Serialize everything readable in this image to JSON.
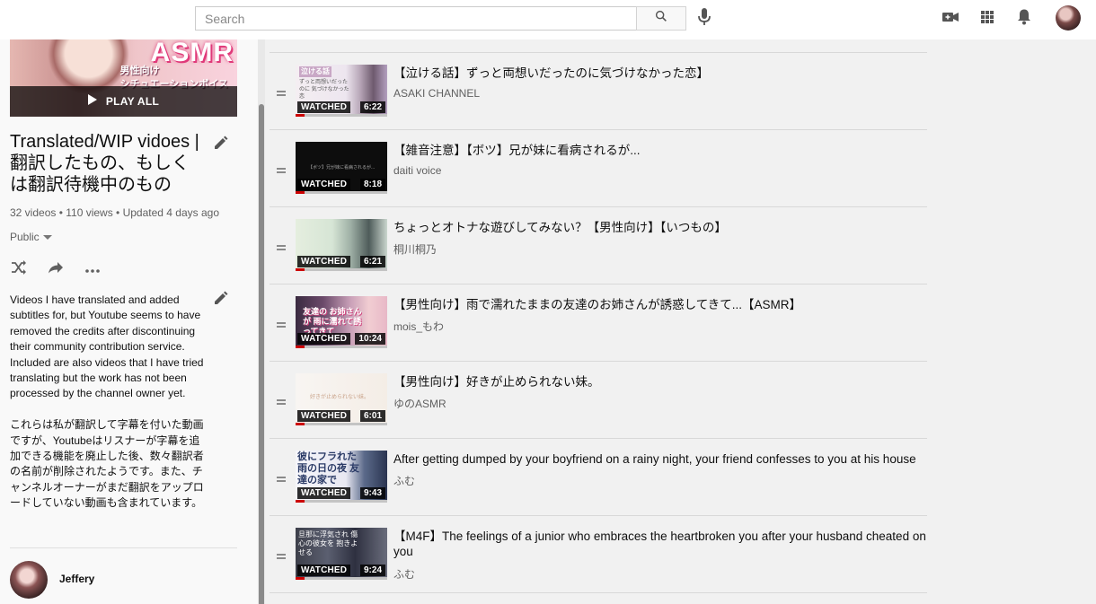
{
  "topbar": {
    "search_placeholder": "Search",
    "icons": [
      "search-icon",
      "mic-icon",
      "video-camera-icon",
      "apps-grid-icon",
      "bell-icon",
      "user-avatar"
    ]
  },
  "sidebar": {
    "thumb_text": {
      "asmr": "ASMR",
      "line1": "男性向け",
      "line2": "シチュエーションボイス",
      "line3": "関西弁彼女"
    },
    "play_all": "PLAY ALL",
    "title": "Translated/WIP vidoes | 翻訳したもの、もしくは翻訳待機中のもの",
    "stats": "32 videos • 110 views • Updated 4 days ago",
    "privacy": "Public",
    "description": "Videos I have translated and added subtitles for, but Youtube seems to have removed the credits after discontinuing their community contribution service. Included are also videos that I have tried translating but the work has not been processed by the channel owner yet.\n\nこれらは私が翻訳して字幕を付いた動画ですが、Youtubeはリスナーが字幕を追加できる機能を廃止した後、数々翻訳者の名前が削除されたようです。また、チャンネルオーナーがまだ翻訳をアップロードしていない動画も含まれています。",
    "owner": "Jeffery"
  },
  "videos": [
    {
      "title": "【泣ける話】ずっと両想いだったのに気づけなかった恋】",
      "channel": "ASAKI CHANNEL",
      "watched": "WATCHED",
      "duration": "6:22",
      "thumb_text": "泣ける話",
      "thumb_sub": "ずっと両想いだったのに 気づけなかった恋"
    },
    {
      "title": "【雑音注意】【ボツ】兄が妹に看病されるが...",
      "channel": "daiti voice",
      "watched": "WATCHED",
      "duration": "8:18",
      "thumb_text": "【ボツ】兄が妹に看病されるが..."
    },
    {
      "title": "ちょっとオトナな遊びしてみない？【男性向け】【いつもの】",
      "channel": "桐川桐乃",
      "watched": "WATCHED",
      "duration": "6:21"
    },
    {
      "title": "【男性向け】雨で濡れたままの友達のお姉さんが誘惑してきて...【ASMR】",
      "channel": "mois_もわ",
      "watched": "WATCHED",
      "duration": "10:24",
      "thumb_text": "友達の お姉さんが 雨に濡れて誘ってきて"
    },
    {
      "title": "【男性向け】好きが止められない妹。",
      "channel": "ゆのASMR",
      "watched": "WATCHED",
      "duration": "6:01",
      "thumb_text": "好きが止められない妹。"
    },
    {
      "title": "After getting dumped by your boyfriend on a rainy night, your friend confesses to you at his house",
      "channel": "ふむ",
      "watched": "WATCHED",
      "duration": "9:43",
      "thumb_text": "彼にフラれた 雨の日の夜 友達の家で"
    },
    {
      "title": "【M4F】The feelings of a junior who embraces the heartbroken you after your husband cheated on you",
      "channel": "ふむ",
      "watched": "WATCHED",
      "duration": "9:24",
      "thumb_text": "旦那に浮気され 傷心の彼女を 抱きよせる"
    }
  ],
  "colors": {
    "accent_red": "#cc0000",
    "background": "#f1f1f1",
    "sidebar_bg": "#f9f9f9",
    "secondary_text": "#606060"
  }
}
